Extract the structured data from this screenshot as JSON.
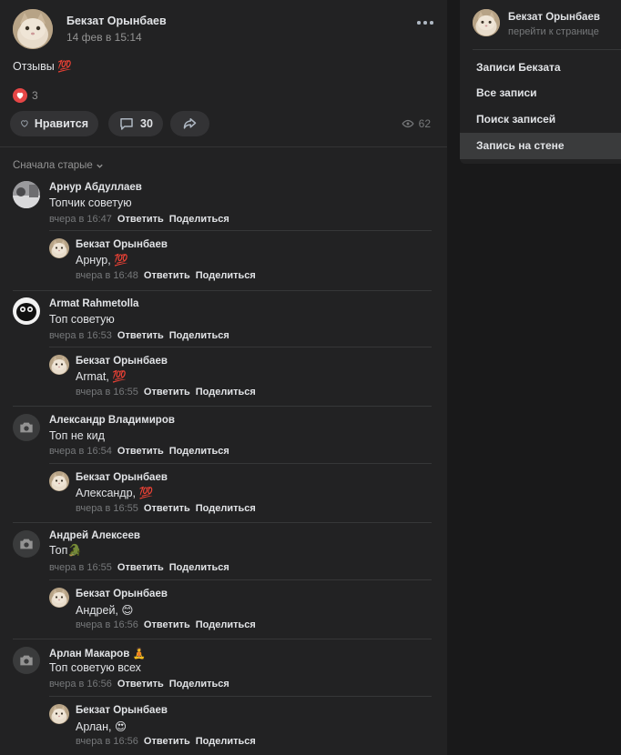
{
  "post": {
    "author": "Бекзат Орынбаев",
    "date": "14 фев в 15:14",
    "text": "Отзывы 💯",
    "reaction_count": "3",
    "like_label": "Нравится",
    "comment_count": "30",
    "views": "62"
  },
  "sort_label": "Сначала старые",
  "actions": {
    "reply": "Ответить",
    "share": "Поделиться"
  },
  "comments": [
    {
      "name": "Арнур Абдуллаев",
      "text": "Топчик советую",
      "time": "вчера в 16:47",
      "reply": {
        "name": "Бекзат Орынбаев",
        "text": "Арнур, 💯",
        "time": "вчера в 16:48"
      }
    },
    {
      "name": "Armat Rahmetolla",
      "text": "Топ советую",
      "time": "вчера в 16:53",
      "reply": {
        "name": "Бекзат Орынбаев",
        "text": "Armat, 💯",
        "time": "вчера в 16:55"
      }
    },
    {
      "name": "Александр Владимиров",
      "text": "Топ не кид",
      "time": "вчера в 16:54",
      "reply": {
        "name": "Бекзат Орынбаев",
        "text": "Александр, 💯",
        "time": "вчера в 16:55"
      }
    },
    {
      "name": "Андрей Алексеев",
      "text": "Топ🐊",
      "time": "вчера в 16:55",
      "reply": {
        "name": "Бекзат Орынбаев",
        "text": "Андрей, 😊",
        "time": "вчера в 16:56"
      }
    },
    {
      "name": "Арлан Макаров 🧘",
      "text": "Топ советую всех",
      "time": "вчера в 16:56",
      "reply": {
        "name": "Бекзат Орынбаев",
        "text": "Арлан, 😍",
        "time": "вчера в 16:56"
      }
    }
  ],
  "sidebar": {
    "name": "Бекзат Орынбаев",
    "link": "перейти к странице",
    "items": [
      {
        "label": "Записи Бекзата",
        "active": false
      },
      {
        "label": "Все записи",
        "active": false
      },
      {
        "label": "Поиск записей",
        "active": false
      },
      {
        "label": "Запись на стене",
        "active": true
      }
    ]
  },
  "colors": {
    "background": "#19191a",
    "panel": "#222223",
    "text": "#e1e3e6",
    "secondary_text": "#939393",
    "heart": "#e64646",
    "button": "#333335"
  }
}
